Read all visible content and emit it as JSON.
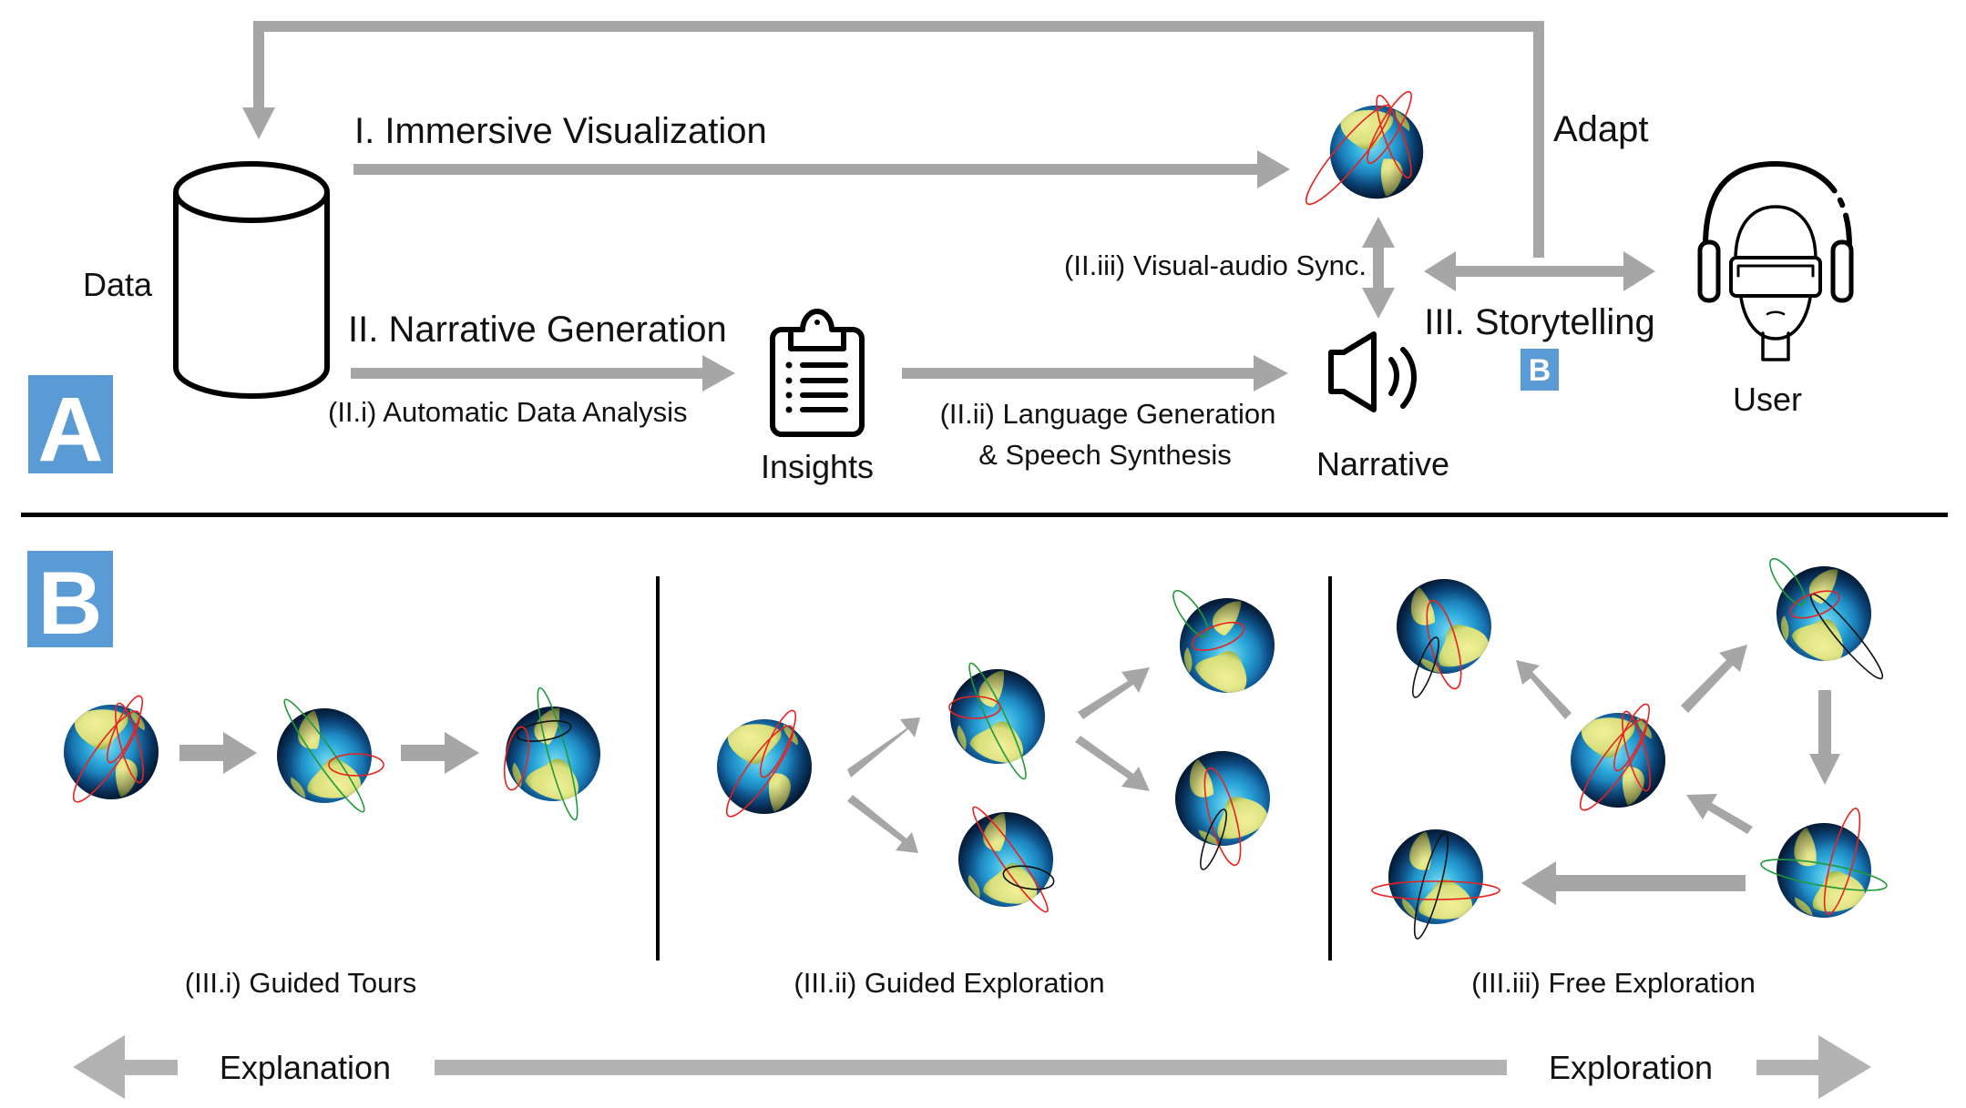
{
  "colors": {
    "arrow": "#a6a6a6",
    "arrow_light": "#b3b3b3",
    "badge": "#5b9bd5",
    "badge_text": "#ffffff",
    "ink": "#000000",
    "orbit_red": "#e8231f",
    "orbit_green": "#1f9a3b",
    "orbit_black": "#111111"
  },
  "panel_a": {
    "badge": "A",
    "feedback_label": "Adapt",
    "nodes": {
      "data": "Data",
      "insights": "Insights",
      "narrative": "Narrative",
      "user": "User"
    },
    "icons": {
      "data": "database-cylinder-icon",
      "visualization": "globe-icon",
      "insights": "clipboard-list-icon",
      "narrative": "speaker-volume-icon",
      "user": "vr-headset-user-icon"
    },
    "stages": {
      "immersive_visualization": "I. Immersive Visualization",
      "narrative_generation": "II. Narrative Generation",
      "automatic_data_analysis": "(II.i) Automatic Data Analysis",
      "language_generation_line1": "(II.ii) Language Generation",
      "language_generation_line2": "& Speech Synthesis",
      "visual_audio_sync": "(II.iii) Visual-audio Sync.",
      "storytelling": "III. Storytelling",
      "storytelling_ref_badge": "B"
    }
  },
  "panel_b": {
    "badge": "B",
    "modes": [
      {
        "caption": "(III.i) Guided Tours",
        "globe_count": 3
      },
      {
        "caption": "(III.ii)  Guided Exploration",
        "globe_count": 5
      },
      {
        "caption": "(III.iii) Free Exploration",
        "globe_count": 5
      }
    ],
    "spectrum": {
      "left_label": "Explanation",
      "right_label": "Exploration"
    }
  }
}
